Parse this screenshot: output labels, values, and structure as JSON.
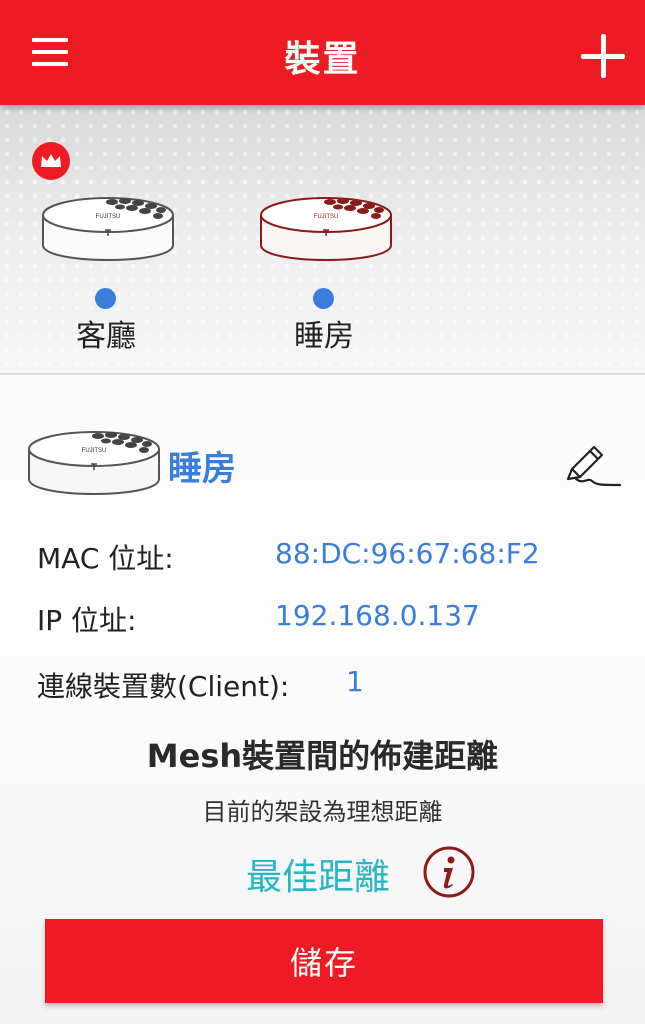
{
  "header": {
    "title": "裝置",
    "menu_icon": "hamburger-menu-icon",
    "add_icon": "plus-icon"
  },
  "devices": [
    {
      "name": "客廳",
      "is_main": true,
      "selected": false,
      "status_color": "#3b7ddd"
    },
    {
      "name": "睡房",
      "is_main": false,
      "selected": true,
      "status_color": "#3b7ddd"
    }
  ],
  "brand": "FUJITSU",
  "detail": {
    "name": "睡房",
    "mac_label": "MAC 位址:",
    "mac_value": "88:DC:96:67:68:F2",
    "ip_label": "IP 位址:",
    "ip_value": "192.168.0.137",
    "clients_label": "連線裝置數(Client):",
    "clients_value": "1"
  },
  "mesh": {
    "title": "Mesh裝置間的佈建距離",
    "subtitle": "目前的架設為理想距離",
    "status": "最佳距離"
  },
  "save_label": "儲存",
  "colors": {
    "accent": "#ee1b24",
    "link": "#3b7ddd",
    "good": "#27b6c4",
    "info": "#8b1a1a"
  }
}
